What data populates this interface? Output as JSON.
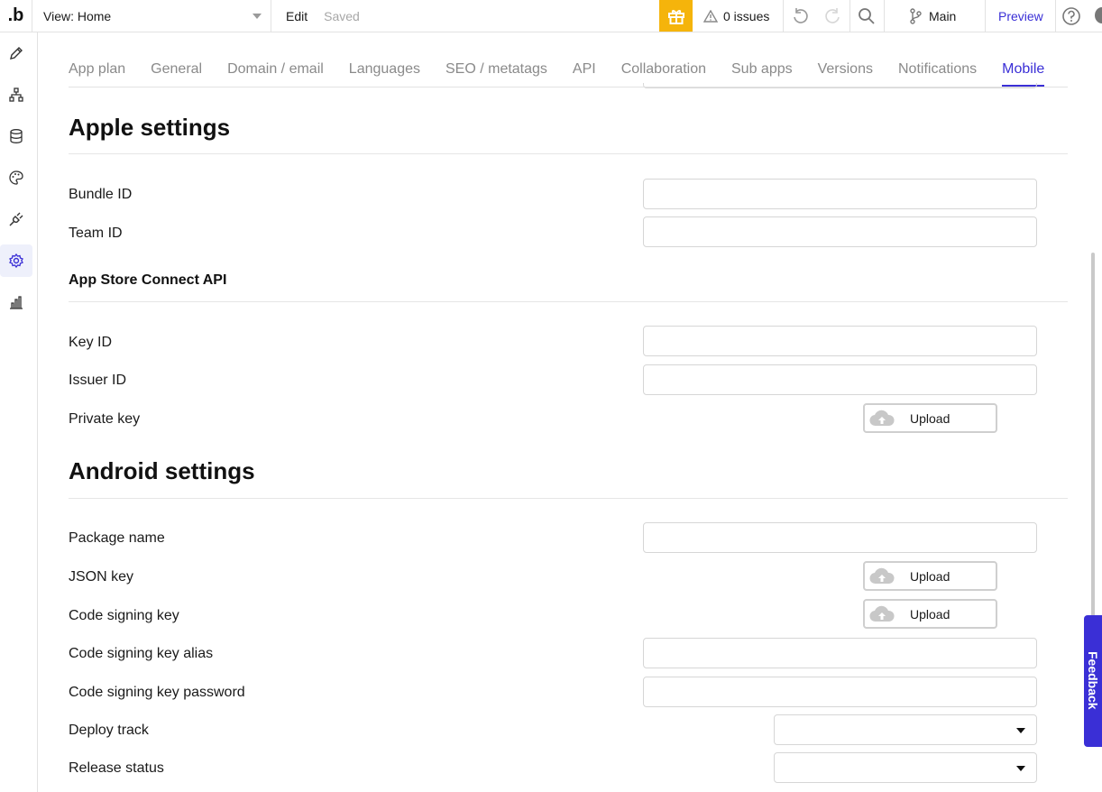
{
  "topbar": {
    "logo": ".b",
    "view_label": "View: Home",
    "edit_label": "Edit",
    "saved_label": "Saved",
    "issues_label": "0 issues",
    "branch_label": "Main",
    "preview_label": "Preview",
    "gift_color": "#f5b40b"
  },
  "sidebar": {
    "items": [
      {
        "icon": "pencil-icon"
      },
      {
        "icon": "workflow-icon"
      },
      {
        "icon": "database-icon"
      },
      {
        "icon": "palette-icon"
      },
      {
        "icon": "plugin-icon"
      },
      {
        "icon": "settings-icon",
        "active": true
      },
      {
        "icon": "analytics-icon"
      }
    ]
  },
  "tabs": [
    {
      "label": "App plan"
    },
    {
      "label": "General"
    },
    {
      "label": "Domain / email"
    },
    {
      "label": "Languages"
    },
    {
      "label": "SEO / metatags"
    },
    {
      "label": "API"
    },
    {
      "label": "Collaboration"
    },
    {
      "label": "Sub apps"
    },
    {
      "label": "Versions"
    },
    {
      "label": "Notifications"
    },
    {
      "label": "Mobile",
      "active": true
    }
  ],
  "apple": {
    "title": "Apple settings",
    "bundle_id_label": "Bundle ID",
    "team_id_label": "Team ID",
    "api_title": "App Store Connect API",
    "key_id_label": "Key ID",
    "issuer_id_label": "Issuer ID",
    "private_key_label": "Private key",
    "upload_label": "Upload"
  },
  "android": {
    "title": "Android settings",
    "package_name_label": "Package name",
    "json_key_label": "JSON key",
    "code_signing_key_label": "Code signing key",
    "code_signing_alias_label": "Code signing key alias",
    "code_signing_password_label": "Code signing key password",
    "deploy_track_label": "Deploy track",
    "release_status_label": "Release status",
    "upload_label": "Upload"
  },
  "feedback_label": "Feedback",
  "accent_color": "#3a2fd6"
}
